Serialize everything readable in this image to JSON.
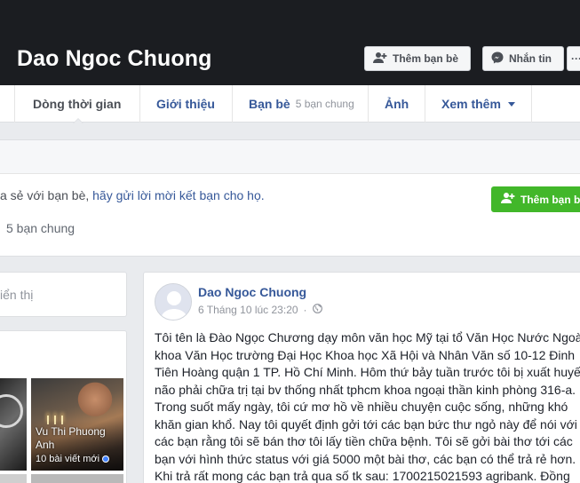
{
  "header": {
    "profile_name": "Dao Ngoc Chuong",
    "add_friend_label": "Thêm bạn bè",
    "message_label": "Nhắn tin",
    "more_label": "···"
  },
  "nav": {
    "timeline": "Dòng thời gian",
    "about": "Giới thiệu",
    "friends": "Bạn bè",
    "friends_mutual": "5 bạn chung",
    "photos": "Ảnh",
    "more": "Xem thêm"
  },
  "suggestion": {
    "text_prefix": "a sẻ với bạn bè, ",
    "text_link": "hãy gửi lời mời kết bạn cho họ.",
    "add_button": "Thêm bạn bè",
    "mutual": "5 bạn chung"
  },
  "left": {
    "card1_text": "iển thị",
    "friend_name": "Vu Thi Phuong Anh",
    "friend_posts": "10 bài viết mới"
  },
  "post": {
    "author": "Dao Ngoc Chuong",
    "timestamp": "6 Tháng 10 lúc 23:20",
    "lines": [
      "Tôi tên là Đào Ngọc Chương dạy môn văn học Mỹ tại tổ Văn Học Nước Ngoài",
      "khoa Văn Học trường Đại Học Khoa học Xã Hội và Nhân Văn số 10-12 Đinh",
      "Tiên Hoàng quận 1 TP. Hồ Chí Minh. Hôm thứ bảy tuần trước tôi bị xuất huyết",
      "não phải chữa trị tại bv thống nhất tphcm khoa ngoại thần kinh phòng 316-a.",
      "Trong suốt mấy ngày, tôi cứ mơ hồ về nhiều chuyện cuộc sống, những khó",
      "khăn gian khổ. Nay tôi quyết định gởi tới các bạn bức thư ngỏ này để nói với",
      "các bạn rằng tôi sẽ bán thơ tôi lấy tiền chữa bệnh. Tôi sẽ gởi bài thơ tới các",
      "bạn với hình thức status với giá 5000 một bài thơ, các bạn có thể trả rẻ hơn.",
      "Khi trả rất mong các bạn trả qua số tk sau: 1700215021593 agribank. Đồng"
    ]
  }
}
